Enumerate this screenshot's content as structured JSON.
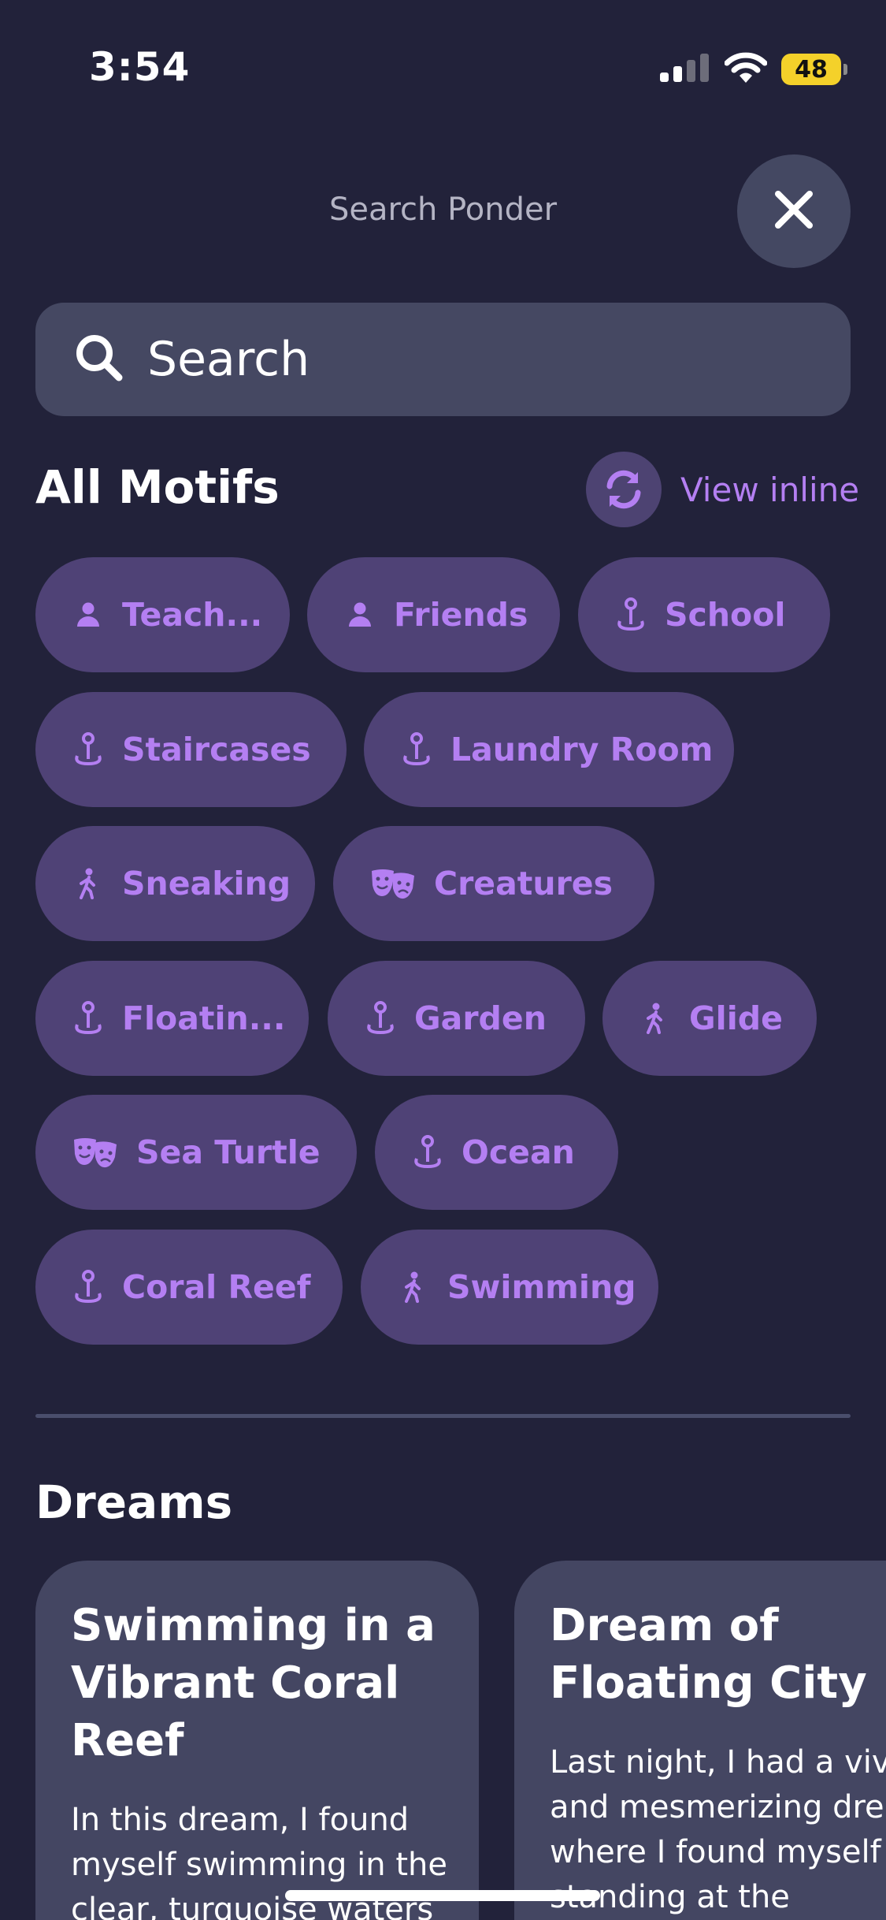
{
  "status_bar": {
    "time": "3:54",
    "battery": "48"
  },
  "header": {
    "title": "Search Ponder"
  },
  "search": {
    "placeholder": "Search"
  },
  "motifs": {
    "title": "All Motifs",
    "view_inline_label": "View inline",
    "chips": [
      {
        "label": "Teach...",
        "icon": "person-icon"
      },
      {
        "label": "Friends",
        "icon": "person-icon"
      },
      {
        "label": "School",
        "icon": "location-pin-icon"
      },
      {
        "label": "Staircases",
        "icon": "location-pin-icon"
      },
      {
        "label": "Laundry Room",
        "icon": "location-pin-icon"
      },
      {
        "label": "Sneaking",
        "icon": "walking-icon"
      },
      {
        "label": "Creatures",
        "icon": "theater-masks-icon"
      },
      {
        "label": "Floatin...",
        "icon": "location-pin-icon"
      },
      {
        "label": "Garden",
        "icon": "location-pin-icon"
      },
      {
        "label": "Glide",
        "icon": "walking-icon"
      },
      {
        "label": "Sea Turtle",
        "icon": "theater-masks-icon"
      },
      {
        "label": "Ocean",
        "icon": "location-pin-icon"
      },
      {
        "label": "Coral Reef",
        "icon": "location-pin-icon"
      },
      {
        "label": "Swimming",
        "icon": "walking-icon"
      }
    ]
  },
  "dreams": {
    "title": "Dreams",
    "cards": [
      {
        "title": "Swimming in a Vibrant Coral Reef",
        "body": "In this dream, I found myself swimming in the clear, turquoise waters"
      },
      {
        "title": "Dream of Floating City",
        "body": "Last night, I had a vivid and mesmerizing dream where I found myself standing at the"
      }
    ]
  },
  "colors": {
    "background": "#22223a",
    "chip_background": "#4f4276",
    "accent": "#b47ff2",
    "card_background": "#444662"
  }
}
